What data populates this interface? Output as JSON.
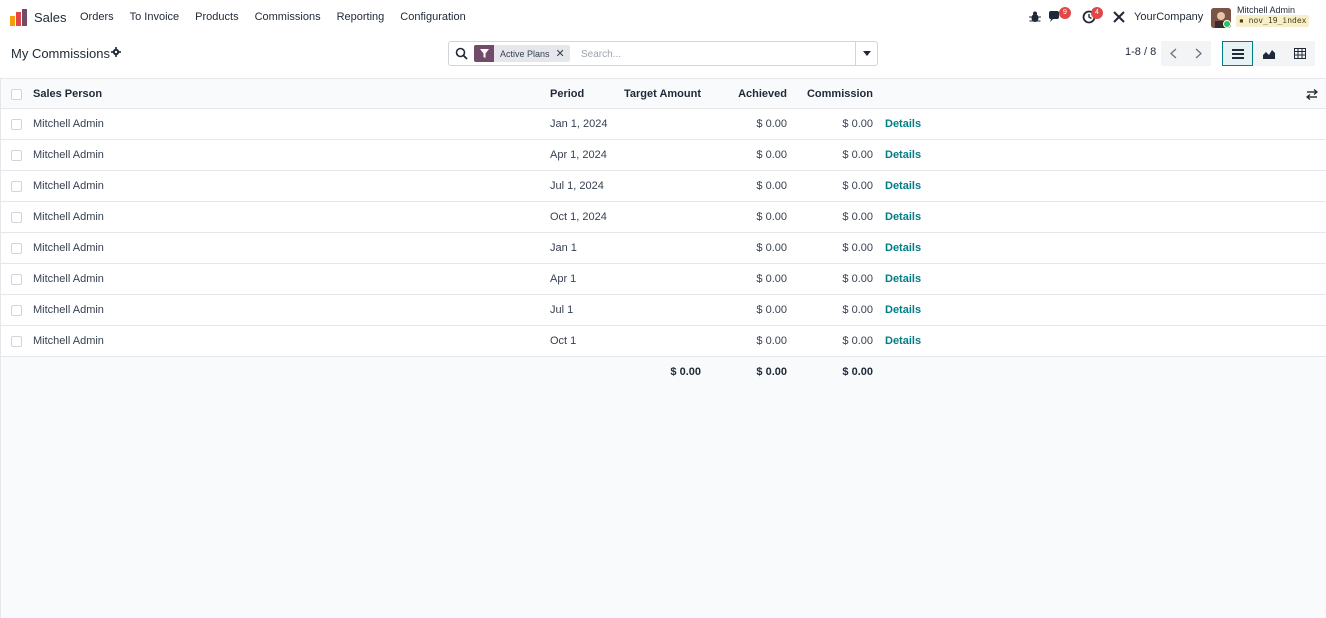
{
  "navbar": {
    "app_name": "Sales",
    "menu": [
      "Orders",
      "To Invoice",
      "Products",
      "Commissions",
      "Reporting",
      "Configuration"
    ],
    "messages_badge": "9",
    "activities_badge": "4",
    "company": "YourCompany",
    "user_name": "Mitchell Admin",
    "db_name": "nov_19_index"
  },
  "control": {
    "title": "My Commissions",
    "facet_label": "Active Plans",
    "search_placeholder": "Search...",
    "pager": "1-8 / 8"
  },
  "table": {
    "headers": {
      "sales_person": "Sales Person",
      "period": "Period",
      "target_amount": "Target Amount",
      "achieved": "Achieved",
      "commission": "Commission"
    },
    "rows": [
      {
        "sales_person": "Mitchell Admin",
        "period": "Jan 1, 2024",
        "target": "",
        "achieved": "$ 0.00",
        "commission": "$ 0.00",
        "details": "Details"
      },
      {
        "sales_person": "Mitchell Admin",
        "period": "Apr 1, 2024",
        "target": "",
        "achieved": "$ 0.00",
        "commission": "$ 0.00",
        "details": "Details"
      },
      {
        "sales_person": "Mitchell Admin",
        "period": "Jul 1, 2024",
        "target": "",
        "achieved": "$ 0.00",
        "commission": "$ 0.00",
        "details": "Details"
      },
      {
        "sales_person": "Mitchell Admin",
        "period": "Oct 1, 2024",
        "target": "",
        "achieved": "$ 0.00",
        "commission": "$ 0.00",
        "details": "Details"
      },
      {
        "sales_person": "Mitchell Admin",
        "period": "Jan 1",
        "target": "",
        "achieved": "$ 0.00",
        "commission": "$ 0.00",
        "details": "Details"
      },
      {
        "sales_person": "Mitchell Admin",
        "period": "Apr 1",
        "target": "",
        "achieved": "$ 0.00",
        "commission": "$ 0.00",
        "details": "Details"
      },
      {
        "sales_person": "Mitchell Admin",
        "period": "Jul 1",
        "target": "",
        "achieved": "$ 0.00",
        "commission": "$ 0.00",
        "details": "Details"
      },
      {
        "sales_person": "Mitchell Admin",
        "period": "Oct 1",
        "target": "",
        "achieved": "$ 0.00",
        "commission": "$ 0.00",
        "details": "Details"
      }
    ],
    "totals": {
      "target": "$ 0.00",
      "achieved": "$ 0.00",
      "commission": "$ 0.00"
    }
  },
  "colors": {
    "accent": "#017e84",
    "brand": "#714b67",
    "badge": "#e04848"
  }
}
